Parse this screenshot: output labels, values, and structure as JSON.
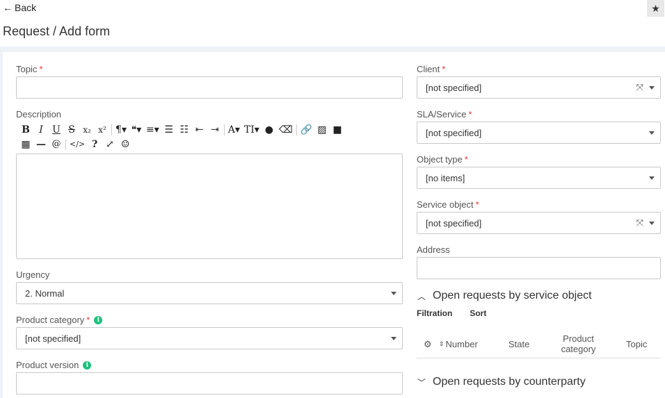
{
  "nav": {
    "back_label": "Back"
  },
  "page": {
    "title": "Request / Add form"
  },
  "left": {
    "topic": {
      "label": "Topic",
      "value": ""
    },
    "description": {
      "label": "Description"
    },
    "urgency": {
      "label": "Urgency",
      "value": "2. Normal"
    },
    "product_category": {
      "label": "Product category",
      "value": "[not specified]"
    },
    "product_version": {
      "label": "Product version",
      "value": ""
    }
  },
  "right": {
    "client": {
      "label": "Client",
      "value": "[not specified]"
    },
    "sla": {
      "label": "SLA/Service",
      "value": "[not specified]"
    },
    "object_type": {
      "label": "Object type",
      "value": "[no items]"
    },
    "service_object": {
      "label": "Service object",
      "value": "[not specified]"
    },
    "address": {
      "label": "Address",
      "value": ""
    }
  },
  "sections": {
    "open_by_object": {
      "title": "Open requests by service object",
      "tabs": [
        "Filtration",
        "Sort"
      ],
      "columns": [
        "Number",
        "State",
        "Product category",
        "Topic"
      ]
    },
    "open_by_counterparty": {
      "title": "Open requests by counterparty"
    }
  },
  "required_mark": "*",
  "info_glyph": "i",
  "icons": {
    "back": "arrow-left-icon",
    "star": "star-icon",
    "expand": "expand-arrows-icon",
    "settings": "gear-icon",
    "sort": "sort-arrows-icon",
    "chevron_up": "chevron-up-icon",
    "chevron_down": "chevron-down-icon"
  },
  "colors": {
    "required": "#e53935",
    "info": "#19c37d",
    "band": "#eef1f6"
  }
}
